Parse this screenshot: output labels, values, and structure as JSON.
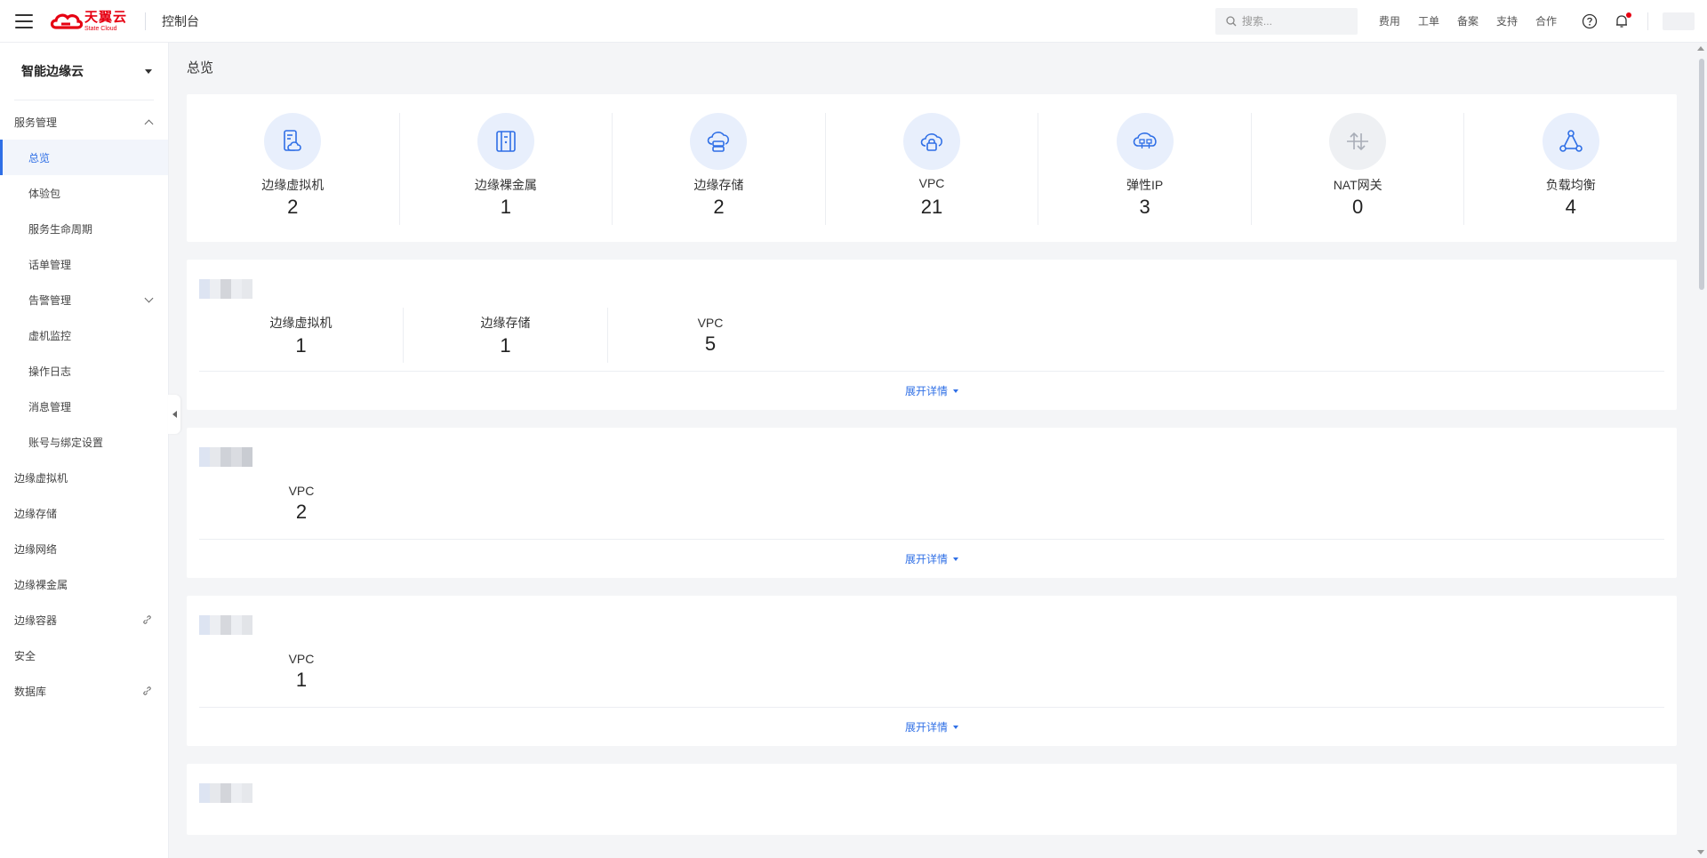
{
  "topbar": {
    "logo_cn": "天翼云",
    "logo_en": "State Cloud",
    "console_title": "控制台",
    "search_placeholder": "搜索...",
    "links": [
      "费用",
      "工单",
      "备案",
      "支持",
      "合作"
    ]
  },
  "sidebar": {
    "product": "智能边缘云",
    "items": [
      {
        "label": "服务管理",
        "type": "group",
        "expanded": true
      },
      {
        "label": "总览",
        "type": "sub",
        "active": true
      },
      {
        "label": "体验包",
        "type": "sub"
      },
      {
        "label": "服务生命周期",
        "type": "sub"
      },
      {
        "label": "话单管理",
        "type": "sub"
      },
      {
        "label": "告警管理",
        "type": "sub",
        "expandable": true
      },
      {
        "label": "虚机监控",
        "type": "sub"
      },
      {
        "label": "操作日志",
        "type": "sub"
      },
      {
        "label": "消息管理",
        "type": "sub"
      },
      {
        "label": "账号与绑定设置",
        "type": "sub"
      },
      {
        "label": "边缘虚拟机",
        "type": "top"
      },
      {
        "label": "边缘存储",
        "type": "top"
      },
      {
        "label": "边缘网络",
        "type": "top"
      },
      {
        "label": "边缘裸金属",
        "type": "top"
      },
      {
        "label": "边缘容器",
        "type": "top",
        "external": true
      },
      {
        "label": "安全",
        "type": "top"
      },
      {
        "label": "数据库",
        "type": "top",
        "external": true
      }
    ]
  },
  "main": {
    "title": "总览",
    "summary": [
      {
        "label": "边缘虚拟机",
        "value": "2",
        "icon": "vm-cloud-icon"
      },
      {
        "label": "边缘裸金属",
        "value": "1",
        "icon": "bare-metal-icon"
      },
      {
        "label": "边缘存储",
        "value": "2",
        "icon": "storage-cloud-icon"
      },
      {
        "label": "VPC",
        "value": "21",
        "icon": "vpc-lock-icon"
      },
      {
        "label": "弹性IP",
        "value": "3",
        "icon": "elastic-ip-icon"
      },
      {
        "label": "NAT网关",
        "value": "0",
        "icon": "nat-gateway-icon"
      },
      {
        "label": "负载均衡",
        "value": "4",
        "icon": "load-balancer-icon"
      }
    ],
    "expand_label": "展开详情",
    "regions": [
      {
        "stats": [
          {
            "label": "边缘虚拟机",
            "value": "1"
          },
          {
            "label": "边缘存储",
            "value": "1"
          },
          {
            "label": "VPC",
            "value": "5"
          }
        ]
      },
      {
        "stats": [
          {
            "label": "VPC",
            "value": "2"
          }
        ]
      },
      {
        "stats": [
          {
            "label": "VPC",
            "value": "1"
          }
        ]
      }
    ]
  },
  "colors": {
    "accent": "#2f6fe6",
    "brand": "#e60012",
    "icon_bg": "#e8effc"
  }
}
